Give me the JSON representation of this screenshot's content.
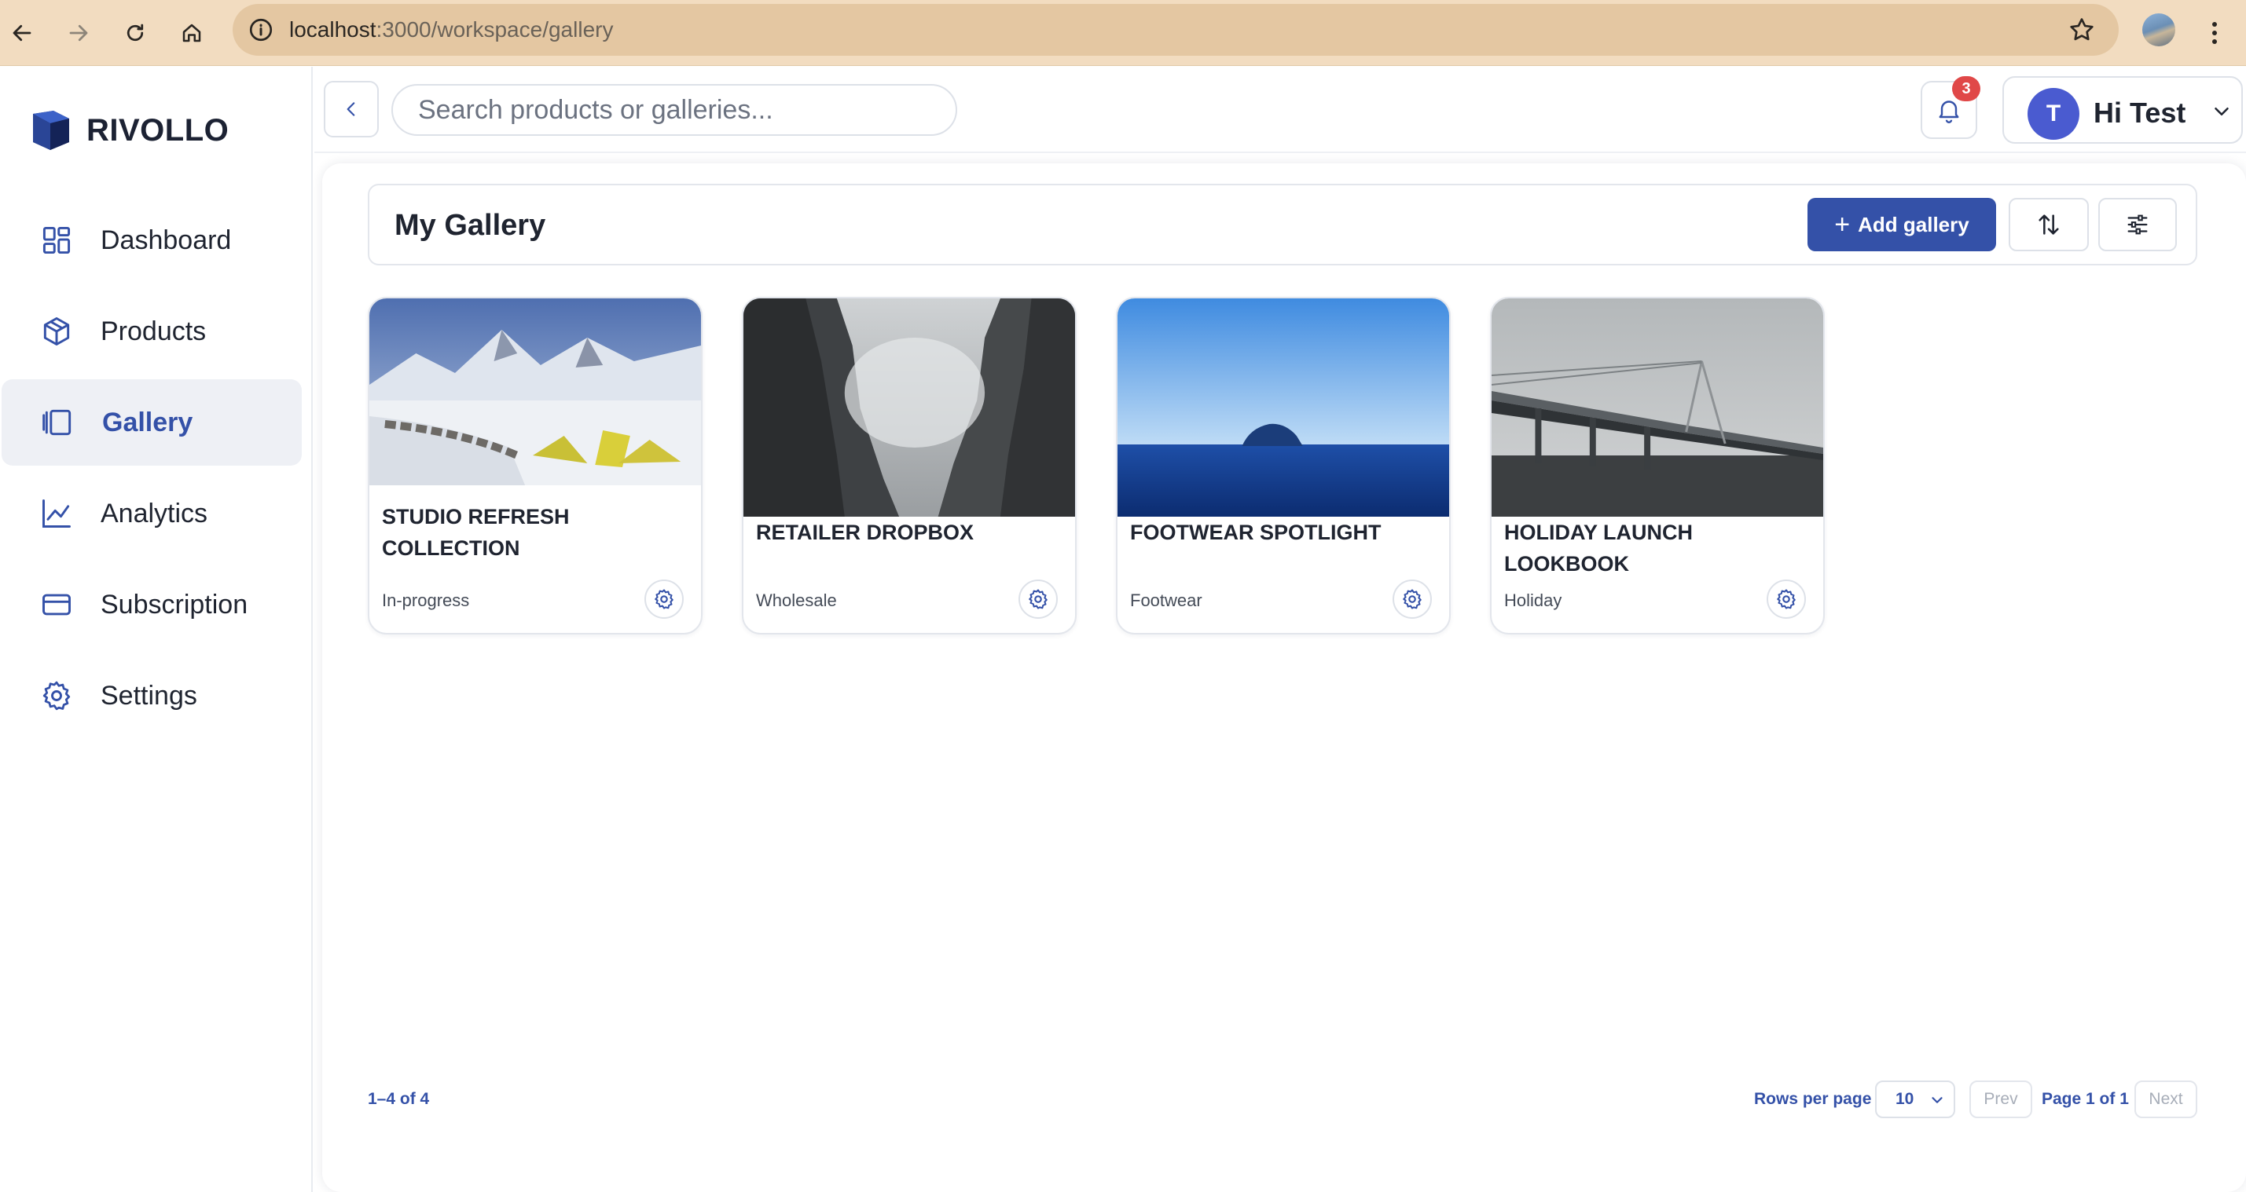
{
  "browser": {
    "url_host": "localhost",
    "url_rest": ":3000/workspace/gallery"
  },
  "brand": {
    "name": "RIVOLLO"
  },
  "sidebar": {
    "items": [
      {
        "label": "Dashboard",
        "icon": "dashboard-icon",
        "active": false
      },
      {
        "label": "Products",
        "icon": "box-icon",
        "active": false
      },
      {
        "label": "Gallery",
        "icon": "gallery-icon",
        "active": true
      },
      {
        "label": "Analytics",
        "icon": "chart-line-icon",
        "active": false
      },
      {
        "label": "Subscription",
        "icon": "credit-card-icon",
        "active": false
      },
      {
        "label": "Settings",
        "icon": "gear-icon",
        "active": false
      }
    ]
  },
  "header": {
    "search_placeholder": "Search products or galleries...",
    "notification_count": "3",
    "user_initial": "T",
    "user_greeting": "Hi Test"
  },
  "gallery": {
    "title": "My Gallery",
    "add_label": "Add gallery",
    "cards": [
      {
        "title": "STUDIO REFRESH COLLECTION",
        "tag": "In-progress"
      },
      {
        "title": "RETAILER DROPBOX",
        "tag": "Wholesale"
      },
      {
        "title": "FOOTWEAR SPOTLIGHT",
        "tag": "Footwear"
      },
      {
        "title": "HOLIDAY LAUNCH LOOKBOOK",
        "tag": "Holiday"
      }
    ]
  },
  "pagination": {
    "range": "1–4 of 4",
    "rows_label": "Rows per page",
    "rows_value": "10",
    "prev": "Prev",
    "page_info": "Page 1 of 1",
    "next": "Next"
  },
  "colors": {
    "accent": "#3451a8",
    "badge": "#e04848",
    "chrome": "#f2dcc0"
  }
}
